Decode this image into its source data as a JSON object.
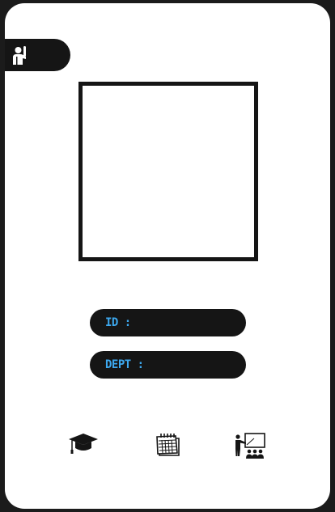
{
  "card": {
    "badge_icon": "student-raising-hand-icon",
    "id_label": "ID :",
    "dept_label": "DEPT :"
  },
  "footer_icons": [
    {
      "name": "graduation-cap-icon"
    },
    {
      "name": "calendar-icon"
    },
    {
      "name": "teacher-presentation-icon"
    }
  ],
  "colors": {
    "background": "#1b1b1b",
    "card": "#ffffff",
    "dark": "#151515",
    "label_blue": "#3da8ee"
  }
}
